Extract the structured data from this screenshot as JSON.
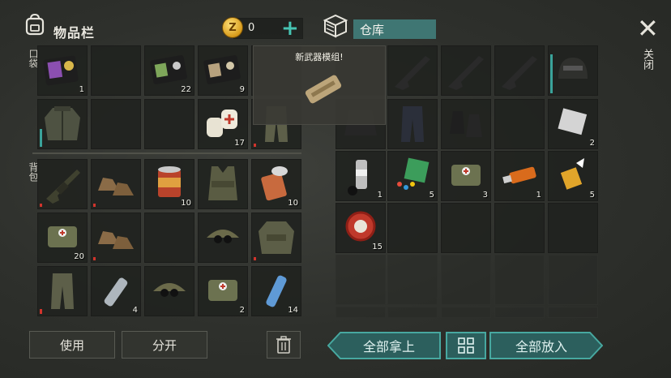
{
  "header": {
    "inventory_title": "物品栏",
    "coin_value": "0",
    "plus_label": "+",
    "storage_title": "仓库",
    "close_label": "关闭",
    "close_symbol": "✕"
  },
  "sections": {
    "pockets_label": "口袋",
    "backpack_label": "背包"
  },
  "popup": {
    "title": "新武器模组!"
  },
  "pockets": [
    {
      "icon": "police-badge-wallet-icon",
      "count": "1"
    },
    {
      "icon": "",
      "count": ""
    },
    {
      "icon": "wallet-icon",
      "count": "22"
    },
    {
      "icon": "wallet-icon",
      "count": "9"
    },
    {
      "icon": "",
      "count": ""
    },
    {
      "icon": "jacket-icon",
      "count": ""
    },
    {
      "icon": "",
      "count": ""
    },
    {
      "icon": "",
      "count": ""
    },
    {
      "icon": "bandage-icon",
      "count": "17"
    },
    {
      "icon": "pants-icon",
      "count": ""
    }
  ],
  "backpack": [
    {
      "icon": "rifle-icon",
      "count": ""
    },
    {
      "icon": "boots-icon",
      "count": ""
    },
    {
      "icon": "canned-food-icon",
      "count": "10"
    },
    {
      "icon": "vest-icon",
      "count": ""
    },
    {
      "icon": "open-can-icon",
      "count": "10"
    },
    {
      "icon": "medkit-bag-icon",
      "count": "20"
    },
    {
      "icon": "boots-icon",
      "count": ""
    },
    {
      "icon": "",
      "count": ""
    },
    {
      "icon": "cap-goggles-icon",
      "count": ""
    },
    {
      "icon": "jacket-icon",
      "count": ""
    },
    {
      "icon": "pants-icon",
      "count": ""
    },
    {
      "icon": "water-bottle-icon",
      "count": "4"
    },
    {
      "icon": "cap-goggles-icon",
      "count": ""
    },
    {
      "icon": "medkit-bag-icon",
      "count": "2"
    },
    {
      "icon": "water-bottle-icon",
      "count": "14"
    }
  ],
  "storage": [
    {
      "icon": "",
      "count": ""
    },
    {
      "icon": "rifle-icon",
      "count": ""
    },
    {
      "icon": "rifle-icon",
      "count": ""
    },
    {
      "icon": "rifle-icon",
      "count": ""
    },
    {
      "icon": "helmet-icon",
      "count": ""
    },
    {
      "icon": "tactical-vest-icon",
      "count": ""
    },
    {
      "icon": "armored-pants-icon",
      "count": ""
    },
    {
      "icon": "boots-icon",
      "count": ""
    },
    {
      "icon": "",
      "count": ""
    },
    {
      "icon": "metal-sheet-icon",
      "count": "2"
    },
    {
      "icon": "spray-can-icon",
      "count": "1"
    },
    {
      "icon": "pills-icon",
      "count": "5"
    },
    {
      "icon": "medkit-bag-icon",
      "count": "3"
    },
    {
      "icon": "usb-drive-icon",
      "count": "1"
    },
    {
      "icon": "glue-icon",
      "count": "5"
    },
    {
      "icon": "bottle-cap-icon",
      "count": "15"
    }
  ],
  "actions": {
    "use_label": "使用",
    "split_label": "分开",
    "take_all_label": "全部拿上",
    "put_all_label": "全部放入"
  },
  "colors": {
    "accent": "#47a8a0",
    "durability_low": "#d1342c"
  }
}
